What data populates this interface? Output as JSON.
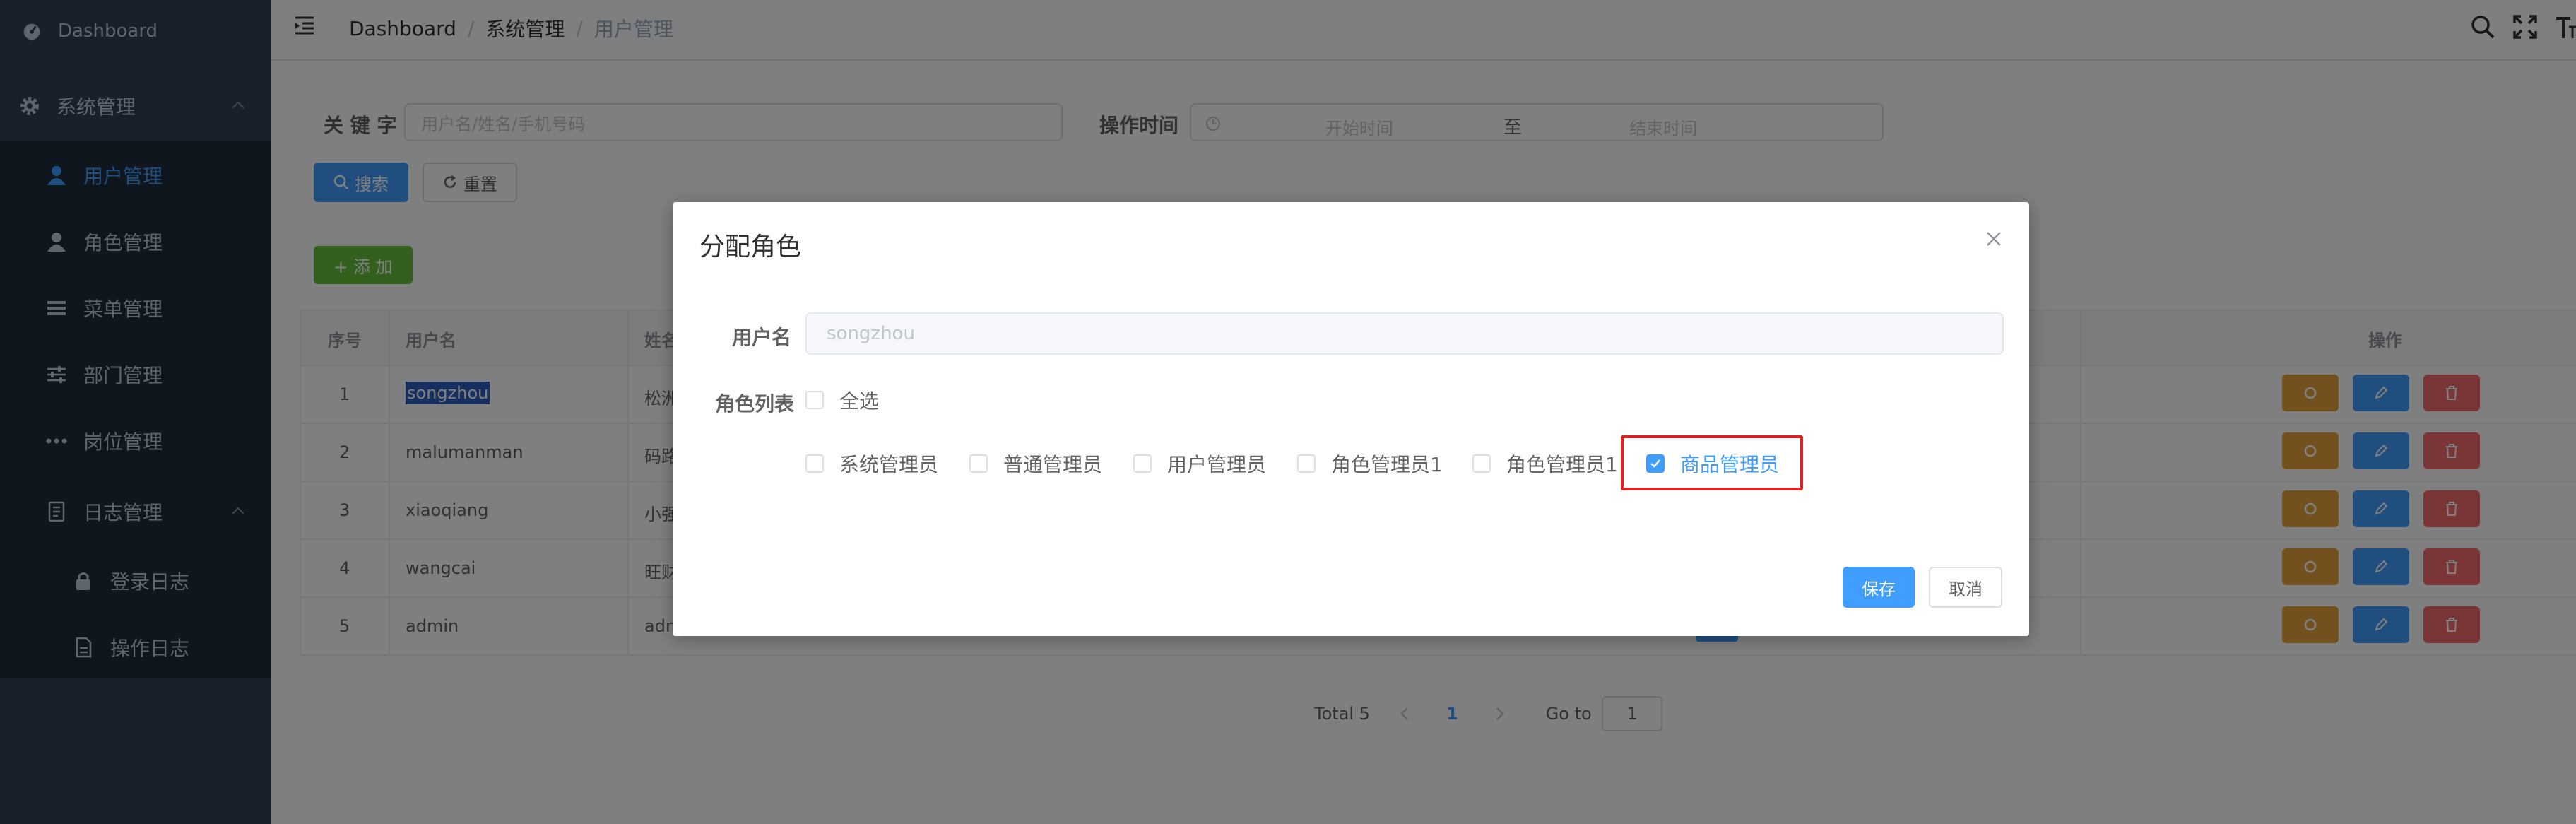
{
  "sidebar": {
    "dashboard": "Dashboard",
    "system_group": "系统管理",
    "items": [
      {
        "label": "用户管理",
        "icon": "user-icon",
        "active": true
      },
      {
        "label": "角色管理",
        "icon": "user-role-icon"
      },
      {
        "label": "菜单管理",
        "icon": "menu-icon"
      },
      {
        "label": "部门管理",
        "icon": "sliders-icon"
      },
      {
        "label": "岗位管理",
        "icon": "more-dots-icon"
      }
    ],
    "log_group": "日志管理",
    "log_items": [
      {
        "label": "登录日志",
        "icon": "lock-icon"
      },
      {
        "label": "操作日志",
        "icon": "document-icon"
      }
    ],
    "active_color": "#409eff",
    "bg_color": "#304156"
  },
  "header": {
    "breadcrumb": [
      "Dashboard",
      "系统管理",
      "用户管理"
    ],
    "breadcrumb_sep": "/"
  },
  "search": {
    "keyword_label": "关 键 字",
    "keyword_placeholder": "用户名/姓名/手机号码",
    "time_label": "操作时间",
    "start_placeholder": "开始时间",
    "range_sep": "至",
    "end_placeholder": "结束时间",
    "search_btn": "搜索",
    "reset_btn": "重置"
  },
  "toolbar": {
    "add_btn": "+ 添 加"
  },
  "table": {
    "headers": {
      "index": "序号",
      "username": "用户名",
      "name": "姓名",
      "ops": "操作"
    },
    "rows": [
      {
        "index": "1",
        "username": "songzhou",
        "name": "松洲"
      },
      {
        "index": "2",
        "username": "malumanman",
        "name": "码路"
      },
      {
        "index": "3",
        "username": "xiaoqiang",
        "name": "小强"
      },
      {
        "index": "4",
        "username": "wangcai",
        "name": "旺财"
      },
      {
        "index": "5",
        "username": "admin",
        "name": "adm"
      }
    ]
  },
  "pagination": {
    "total": "Total 5",
    "current_page": "1",
    "goto_label": "Go to",
    "goto_value": "1"
  },
  "dialog": {
    "title": "分配角色",
    "username_label": "用户名",
    "username_value": "songzhou",
    "roles_label": "角色列表",
    "select_all": "全选",
    "roles": [
      {
        "label": "系统管理员",
        "checked": false
      },
      {
        "label": "普通管理员",
        "checked": false
      },
      {
        "label": "用户管理员",
        "checked": false
      },
      {
        "label": "角色管理员1",
        "checked": false
      },
      {
        "label": "角色管理员1",
        "checked": false
      },
      {
        "label": "商品管理员",
        "checked": true
      }
    ],
    "save_btn": "保存",
    "cancel_btn": "取消"
  },
  "colors": {
    "primary": "#409eff",
    "success": "#67c23a",
    "warning": "#e6a23c",
    "danger": "#f56c6c",
    "highlight_box": "#e02020"
  }
}
